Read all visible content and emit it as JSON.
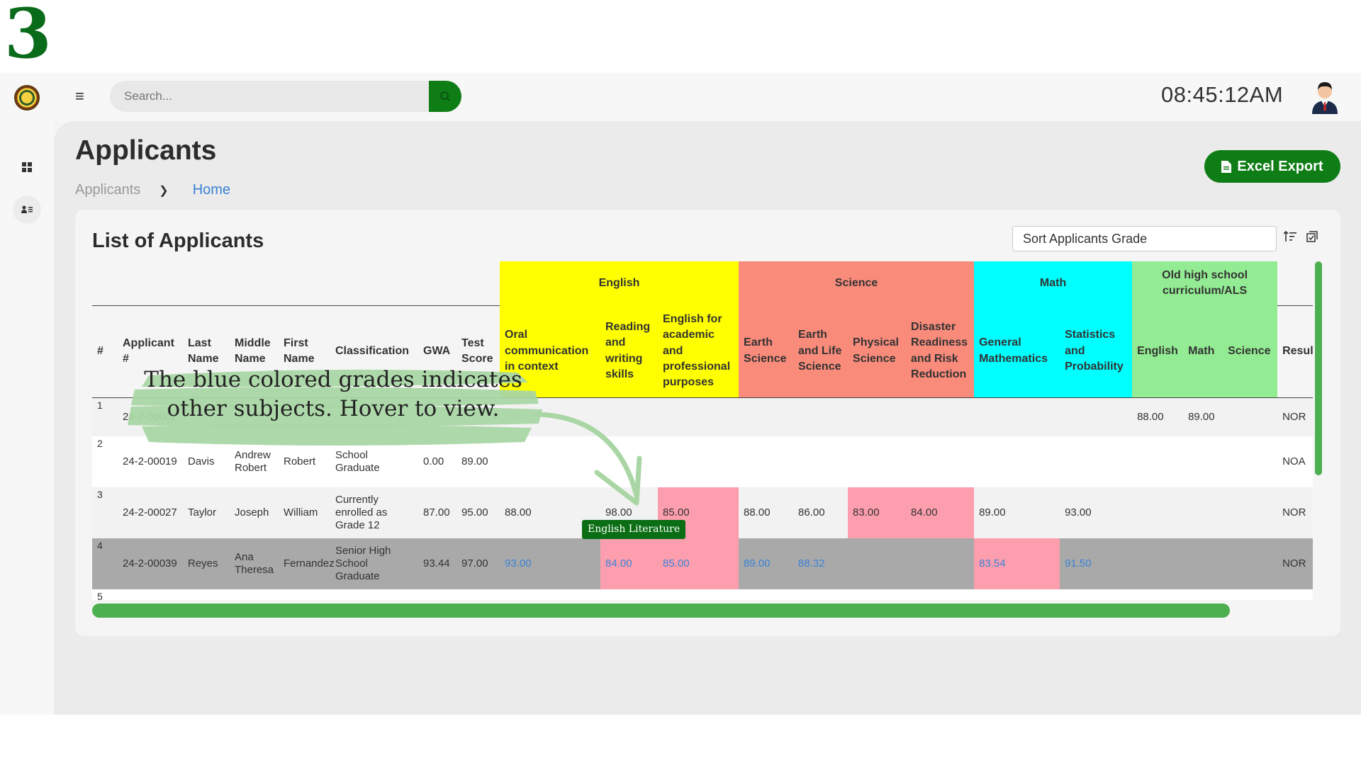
{
  "step_number": "3",
  "header": {
    "menu_icon": "hamburger-icon",
    "search_placeholder": "Search...",
    "search_icon": "search-icon",
    "clock": "08:45:12AM"
  },
  "sidebar": {
    "items": [
      {
        "icon": "dashboard-icon"
      },
      {
        "icon": "applicants-icon"
      }
    ]
  },
  "page": {
    "title": "Applicants",
    "breadcrumb": [
      "Applicants",
      "Home"
    ],
    "export_label": "Excel Export"
  },
  "card": {
    "title": "List of Applicants",
    "sort_label": "Sort Applicants Grade"
  },
  "table": {
    "groups": [
      "English",
      "Science",
      "Math",
      "Old high school curriculum/ALS"
    ],
    "columns": [
      "#",
      "Applicant #",
      "Last Name",
      "Middle Name",
      "First Name",
      "Classification",
      "GWA",
      "Test Score",
      "Oral communication in context",
      "Reading and writing skills",
      "English for academic and professional purposes",
      "Earth Science",
      "Earth and Life Science",
      "Physical Science",
      "Disaster Readiness and Risk Reduction",
      "General Mathematics",
      "Statistics and Probability",
      "English",
      "Math",
      "Science",
      "Result"
    ],
    "rows": [
      {
        "idx": "1",
        "applicant": "24-2-00002",
        "last": "",
        "middle": "",
        "first": "",
        "class": "",
        "gwa": "",
        "test": "",
        "oral": "",
        "rw": "",
        "eap": "",
        "es": "",
        "els": "",
        "ps": "",
        "drrr": "",
        "gm": "",
        "sp": "",
        "old_eng": "88.00",
        "old_math": "89.00",
        "old_sci": "",
        "result": "NOR"
      },
      {
        "idx": "2",
        "applicant": "24-2-00019",
        "last": "Davis",
        "middle": "Andrew Robert",
        "first": "Robert",
        "class": "School Graduate",
        "gwa": "0.00",
        "test": "89.00",
        "oral": "",
        "rw": "",
        "eap": "",
        "es": "",
        "els": "",
        "ps": "",
        "drrr": "",
        "gm": "",
        "sp": "",
        "old_eng": "",
        "old_math": "",
        "old_sci": "",
        "result": "NOA"
      },
      {
        "idx": "3",
        "applicant": "24-2-00027",
        "last": "Taylor",
        "middle": "Joseph",
        "first": "William",
        "class": "Currently enrolled as Grade 12",
        "gwa": "87.00",
        "test": "95.00",
        "oral": "88.00",
        "rw": "98.00",
        "eap": "85.00",
        "es": "88.00",
        "els": "86.00",
        "ps": "83.00",
        "drrr": "84.00",
        "gm": "89.00",
        "sp": "93.00",
        "old_eng": "",
        "old_math": "",
        "old_sci": "",
        "result": "NOR"
      },
      {
        "idx": "4",
        "applicant": "24-2-00039",
        "last": "Reyes",
        "middle": "Ana Theresa",
        "first": "Fernandez",
        "class": "Senior High School Graduate",
        "gwa": "93.44",
        "test": "97.00",
        "oral": "93.00",
        "rw": "84.00",
        "eap": "85.00",
        "es": "89.00",
        "els": "88.32",
        "ps": "",
        "drrr": "",
        "gm": "83.54",
        "sp": "91.50",
        "old_eng": "",
        "old_math": "",
        "old_sci": "",
        "result": "NOR"
      },
      {
        "idx": "5"
      }
    ]
  },
  "tooltip": "English Literature",
  "annotation": "The blue colored grades indicates other subjects. Hover to view.",
  "colors": {
    "brand_green": "#0f7d16",
    "english": "#ffff00",
    "science": "#f98b7b",
    "math": "#00ffff",
    "old_curriculum": "#93ec93",
    "highlight_pink": "#fd9eae",
    "other_subject_blue": "#3b82d6"
  }
}
